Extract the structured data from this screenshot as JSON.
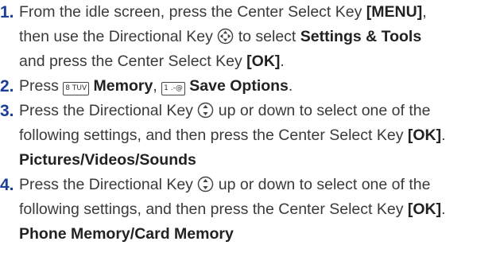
{
  "icons": {
    "nav_key": "four-way-directional-key-icon",
    "updown_key": "up-down-directional-key-icon",
    "key_8": "8-tuv-key-icon",
    "key_1": "1-key-icon"
  },
  "steps": [
    {
      "number": "1.",
      "l1_a": "From the idle screen, press the Center Select Key ",
      "l1_b": "[MENU]",
      "l1_c": ",",
      "l2_a": "then use the Directional Key ",
      "l2_b": " to select ",
      "l2_c": "Settings & Tools",
      "l3_a": "and press the Center Select Key ",
      "l3_b": "[OK]",
      "l3_c": "."
    },
    {
      "number": "2.",
      "a": "Press ",
      "key1": "8 TUV",
      "b": "Memory",
      "c": ", ",
      "key2": "1 .-@",
      "d": "Save Options",
      "e": "."
    },
    {
      "number": "3.",
      "l1_a": "Press the Directional Key ",
      "l1_b": " up or down to select one of the",
      "l2_a": "following settings, and then press the Center Select Key ",
      "l2_b": "[OK]",
      "l2_c": ".",
      "l3": "Pictures/Videos/Sounds"
    },
    {
      "number": "4.",
      "l1_a": "Press the Directional Key ",
      "l1_b": " up or down to select one of the",
      "l2_a": "following settings, and then press the Center Select Key ",
      "l2_b": "[OK]",
      "l2_c": ".",
      "l3": "Phone Memory/Card Memory"
    }
  ]
}
